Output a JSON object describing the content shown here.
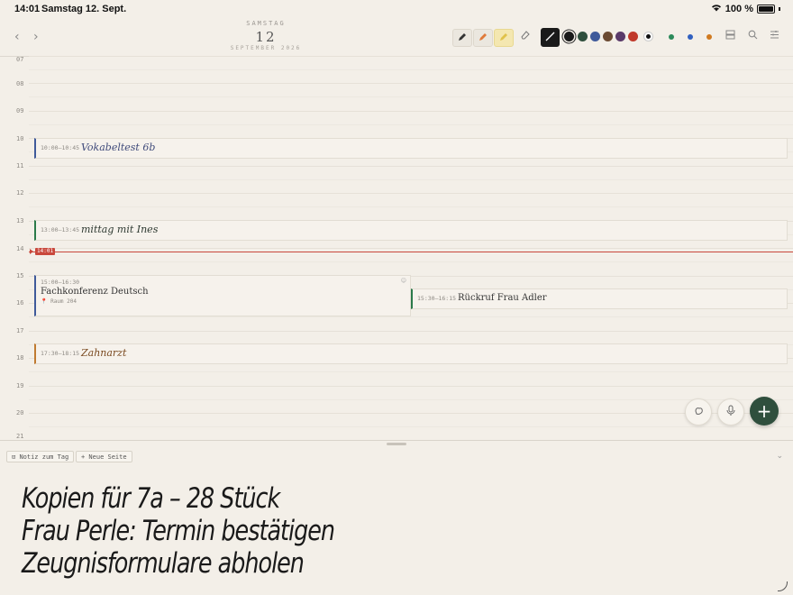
{
  "status_bar": {
    "time": "14:01",
    "date": "Samstag 12. Sept.",
    "wifi_icon": "wifi-icon",
    "battery": "100 %"
  },
  "header": {
    "weekday": "SAMSTAG",
    "day": "12",
    "month_year": "SEPTEMBER 2026"
  },
  "toolbar": {
    "pen_icon": "pen-icon",
    "pencil_icon": "pencil-icon",
    "highlighter_icon": "highlighter-icon",
    "eraser_icon": "eraser-icon",
    "line_tool_icon": "line-icon",
    "colors": [
      "#1a1a1a",
      "#2f4f3d",
      "#3f5a9a",
      "#6b4a32",
      "#5a3a6a",
      "#c0392b"
    ],
    "selected_color": "#1a1a1a",
    "dot_colors": [
      "#2b8a5a",
      "#3060c0",
      "#d07a20"
    ],
    "view_icon": "layout-icon",
    "search_icon": "search-icon",
    "menu_icon": "menu-icon"
  },
  "hours": [
    "07",
    "08",
    "09",
    "10",
    "11",
    "12",
    "13",
    "14",
    "15",
    "16",
    "17",
    "18",
    "19",
    "20",
    "21"
  ],
  "now_label": "14:01",
  "events": [
    {
      "time": "10:00–10:45",
      "title": "Vokabeltest 6b",
      "color": "#3f5a9a",
      "style": "hand"
    },
    {
      "time": "13:00–13:45",
      "title": "mittag mit Ines",
      "color": "#2b7a4a",
      "style": "hand"
    },
    {
      "time": "15:00–16:30",
      "title": "Fachkonferenz Deutsch",
      "location": "📍 Raum 204",
      "color": "#3f5a9a",
      "style": "serif"
    },
    {
      "time": "15:30–16:15",
      "title": "Rückruf Frau Adler",
      "color": "#2b7a4a",
      "style": "serif"
    },
    {
      "time": "17:30–18:15",
      "title": "Zahnarzt",
      "color": "#c07a30",
      "style": "hand"
    }
  ],
  "bottom": {
    "note_button": "Notiz zum Tag",
    "new_page_button": "+ Neue Seite"
  },
  "notes": [
    "Kopien für 7a – 28 Stück",
    "Frau Perle: Termin bestätigen",
    "Zeugnisformulare abholen"
  ]
}
